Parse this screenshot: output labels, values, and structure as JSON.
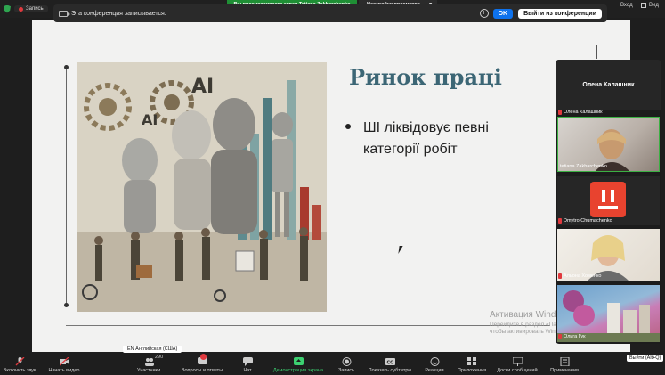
{
  "topbar": {
    "record_label": "Запись",
    "viewing_banner": "Вы просматриваете экран Tetiana Zakharchenko",
    "view_settings": "Настройки просмотра",
    "enter_label": "Вход",
    "view_label": "Вид"
  },
  "notice": {
    "text": "Эта конференция записывается.",
    "ok": "OK",
    "leave": "Выйти из конференции"
  },
  "slide": {
    "title": "Ринок праці",
    "bullet": "ШІ ліквідовує певні категорії робіт",
    "image_text_ai": "AI"
  },
  "watermark": {
    "line1": "Активация Windows",
    "line2": "Перейдите в раздел «Параметры», чтобы активировать Windows."
  },
  "participants": {
    "top_name": "Олена Калашник",
    "items": [
      {
        "label": "Олена Калашник"
      },
      {
        "label": "tetiana Zakharchenko"
      },
      {
        "label": "Dmytro Chumachenko"
      },
      {
        "label": "Альона Хоменко"
      },
      {
        "label": "Ольга Гук"
      }
    ]
  },
  "toolbar": {
    "mute": "Включить звук",
    "video": "Начать видео",
    "participants": "Участники",
    "participants_count": "290",
    "qa": "Вопросы и ответы",
    "chat": "Чат",
    "share": "Демонстрация экрана",
    "record": "Запись",
    "captions": "Показать субтитры",
    "reactions": "Реакции",
    "apps": "Приложения",
    "boards": "Доски сообщений",
    "notes": "Примечания",
    "lang_tip": "EN Английская (США)",
    "exit_tip": "Выйти (Alt+Q)"
  },
  "colors": {
    "accent_blue": "#0e72ed",
    "record_red": "#e0393e",
    "share_green": "#3cd070",
    "title_teal": "#3c6675"
  }
}
